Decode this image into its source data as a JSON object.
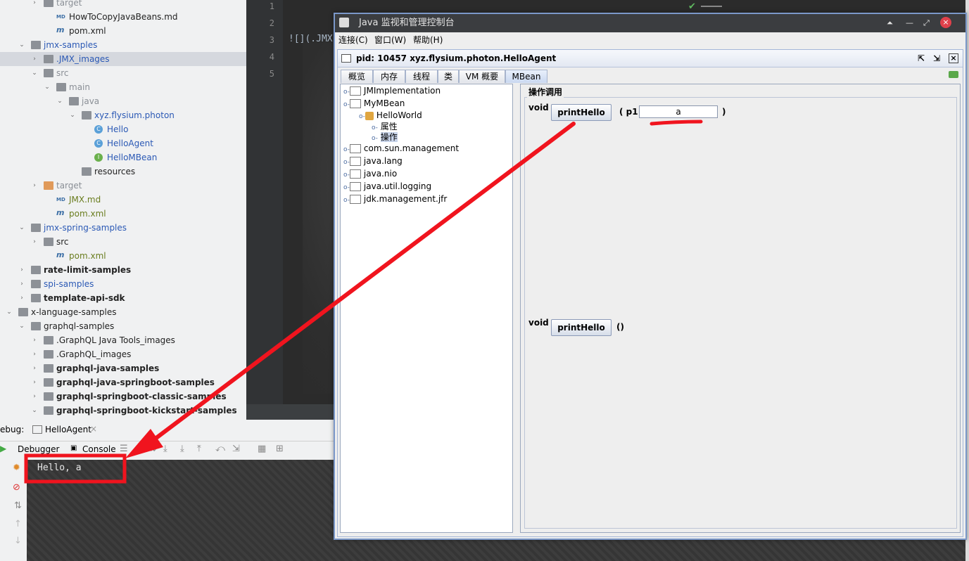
{
  "project_tree": [
    {
      "label": "target",
      "depth": 2,
      "icon": "folder",
      "arrow": "right",
      "color": "gray"
    },
    {
      "label": "HowToCopyJavaBeans.md",
      "depth": 3,
      "icon": "md",
      "color": "default"
    },
    {
      "label": "pom.xml",
      "depth": 3,
      "icon": "mvn",
      "color": "default"
    },
    {
      "label": "jmx-samples",
      "depth": 1,
      "icon": "folder",
      "arrow": "down",
      "color": "blue"
    },
    {
      "label": ".JMX_images",
      "depth": 2,
      "icon": "folder",
      "arrow": "right",
      "color": "blue",
      "selected": true
    },
    {
      "label": "src",
      "depth": 2,
      "icon": "folder",
      "arrow": "down",
      "color": "gray"
    },
    {
      "label": "main",
      "depth": 3,
      "icon": "folder",
      "arrow": "down",
      "color": "gray"
    },
    {
      "label": "java",
      "depth": 4,
      "icon": "folder",
      "arrow": "down",
      "color": "gray"
    },
    {
      "label": "xyz.flysium.photon",
      "depth": 5,
      "icon": "folder",
      "arrow": "down",
      "color": "blue"
    },
    {
      "label": "Hello",
      "depth": 6,
      "icon": "class",
      "color": "green"
    },
    {
      "label": "HelloAgent",
      "depth": 6,
      "icon": "class",
      "color": "green"
    },
    {
      "label": "HelloMBean",
      "depth": 6,
      "icon": "interface",
      "color": "green"
    },
    {
      "label": "resources",
      "depth": 5,
      "icon": "folder",
      "color": "default"
    },
    {
      "label": "target",
      "depth": 2,
      "icon": "folder-orange",
      "arrow": "right",
      "color": "gray"
    },
    {
      "label": "JMX.md",
      "depth": 3,
      "icon": "md",
      "color": "olive"
    },
    {
      "label": "pom.xml",
      "depth": 3,
      "icon": "mvn",
      "color": "olive"
    },
    {
      "label": "jmx-spring-samples",
      "depth": 1,
      "icon": "folder",
      "arrow": "down",
      "color": "blue"
    },
    {
      "label": "src",
      "depth": 2,
      "icon": "folder",
      "arrow": "right",
      "color": "default"
    },
    {
      "label": "pom.xml",
      "depth": 3,
      "icon": "mvn",
      "color": "olive"
    },
    {
      "label": "rate-limit-samples",
      "depth": 1,
      "icon": "folder",
      "arrow": "right",
      "color": "bold"
    },
    {
      "label": "spi-samples",
      "depth": 1,
      "icon": "folder",
      "arrow": "right",
      "color": "blue"
    },
    {
      "label": "template-api-sdk",
      "depth": 1,
      "icon": "folder",
      "arrow": "right",
      "color": "bold"
    },
    {
      "label": "x-language-samples",
      "depth": 0,
      "icon": "folder",
      "arrow": "down",
      "color": "default"
    },
    {
      "label": "graphql-samples",
      "depth": 1,
      "icon": "folder",
      "arrow": "down",
      "color": "default"
    },
    {
      "label": ".GraphQL Java Tools_images",
      "depth": 2,
      "icon": "folder",
      "arrow": "right",
      "color": "default"
    },
    {
      "label": ".GraphQL_images",
      "depth": 2,
      "icon": "folder",
      "arrow": "right",
      "color": "default"
    },
    {
      "label": "graphql-java-samples",
      "depth": 2,
      "icon": "folder",
      "arrow": "right",
      "color": "bold"
    },
    {
      "label": "graphql-java-springboot-samples",
      "depth": 2,
      "icon": "folder",
      "arrow": "right",
      "color": "bold"
    },
    {
      "label": "graphql-springboot-classic-samples",
      "depth": 2,
      "icon": "folder",
      "arrow": "right",
      "color": "bold"
    },
    {
      "label": "graphql-springboot-kickstart-samples",
      "depth": 2,
      "icon": "folder",
      "arrow": "down",
      "color": "bold"
    }
  ],
  "editor": {
    "line_numbers": [
      "1",
      "2",
      "3",
      "4",
      "5"
    ],
    "code_line": "![](.JMX"
  },
  "debug": {
    "label": "ebug:",
    "run_tab": "HelloAgent",
    "tabs": [
      "Debugger",
      "Console"
    ],
    "console_output": "Hello, a"
  },
  "jconsole": {
    "title": "Java 监视和管理控制台",
    "menu": [
      "连接(C)",
      "窗口(W)",
      "帮助(H)"
    ],
    "inner_title": "pid: 10457 xyz.flysium.photon.HelloAgent",
    "tabs": [
      "概览",
      "内存",
      "线程",
      "类",
      "VM 概要",
      "MBean"
    ],
    "active_tab": "MBean",
    "tree": {
      "nodes": [
        "JMImplementation",
        "MyMBean",
        "HelloWorld",
        "属性",
        "操作",
        "com.sun.management",
        "java.lang",
        "java.nio",
        "java.util.logging",
        "jdk.management.jfr"
      ]
    },
    "operations": {
      "group_title": "操作调用",
      "ops": [
        {
          "return_type": "void",
          "name": "printHello",
          "param_label": "( p1",
          "param_value": "a",
          "close": ")"
        },
        {
          "return_type": "void",
          "name": "printHello",
          "params": "()"
        }
      ]
    }
  },
  "colors": {
    "annotation_red": "#f0141e",
    "accent_blue": "#2b59b5"
  }
}
